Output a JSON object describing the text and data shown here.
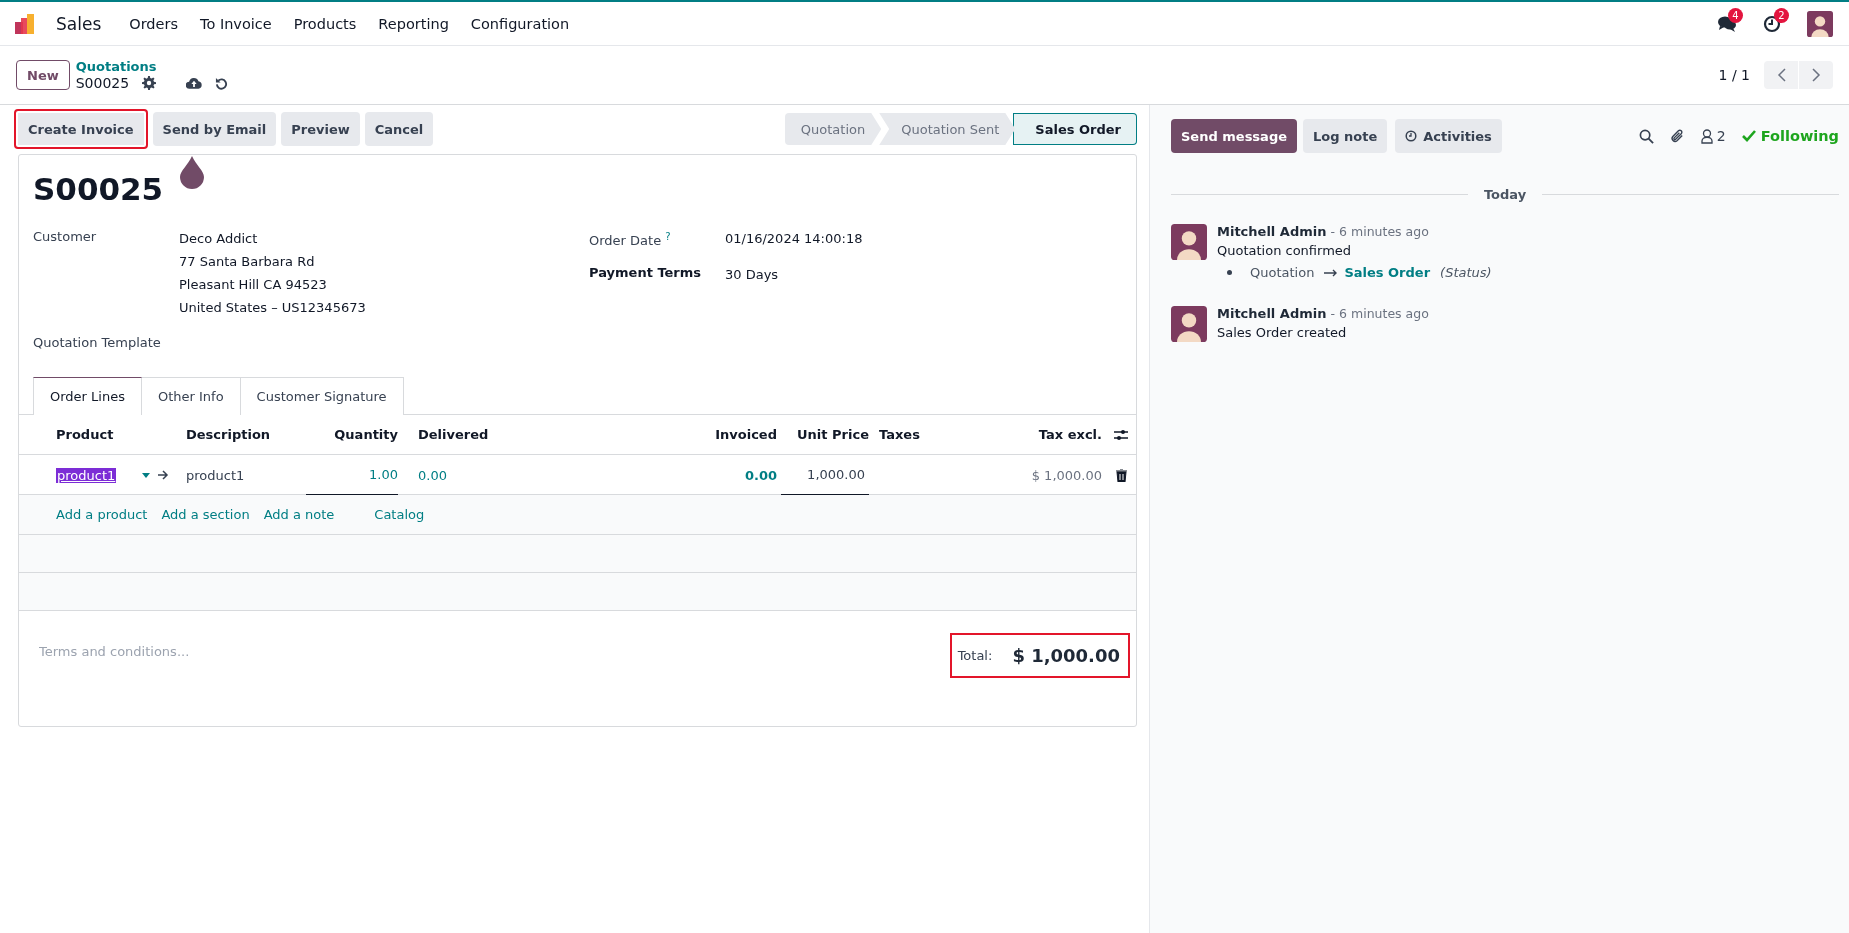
{
  "navbar": {
    "app": "Sales",
    "menus": [
      "Orders",
      "To Invoice",
      "Products",
      "Reporting",
      "Configuration"
    ],
    "messages_count": "4",
    "activities_count": "2"
  },
  "control_panel": {
    "new_button": "New",
    "breadcrumb": "Quotations",
    "record": "S00025",
    "pager": "1 / 1"
  },
  "action_buttons": [
    {
      "label": "Create Invoice",
      "highlighted": true
    },
    {
      "label": "Send by Email",
      "highlighted": false
    },
    {
      "label": "Preview",
      "highlighted": false
    },
    {
      "label": "Cancel",
      "highlighted": false
    }
  ],
  "statusbar": [
    {
      "label": "Quotation",
      "selected": false
    },
    {
      "label": "Quotation Sent",
      "selected": false
    },
    {
      "label": "Sales Order",
      "selected": true
    }
  ],
  "form": {
    "title": "S00025",
    "customer_label": "Customer",
    "customer_name": "Deco Addict",
    "address": [
      "77 Santa Barbara Rd",
      "Pleasant Hill CA 94523",
      "United States – US12345673"
    ],
    "template_label": "Quotation Template",
    "order_date_label": "Order Date",
    "help_mark": "?",
    "order_date": "01/16/2024 14:00:18",
    "payment_terms_label": "Payment Terms",
    "payment_terms": "30 Days"
  },
  "tabs": [
    {
      "label": "Order Lines",
      "selected": true
    },
    {
      "label": "Other Info",
      "selected": false
    },
    {
      "label": "Customer Signature",
      "selected": false
    }
  ],
  "table": {
    "columns": [
      "Product",
      "Description",
      "Quantity",
      "Delivered",
      "Invoiced",
      "Unit Price",
      "Taxes",
      "Tax excl."
    ],
    "rows": [
      {
        "product": "product1",
        "text_selected": true,
        "description": "product1",
        "quantity": "1.00",
        "delivered": "0.00",
        "invoiced": "0.00",
        "unit_price": "1,000.00",
        "tax_excl": "$ 1,000.00"
      }
    ],
    "add_links": [
      "Add a product",
      "Add a section",
      "Add a note",
      "Catalog"
    ]
  },
  "terms": {
    "placeholder": "Terms and conditions..."
  },
  "total": {
    "label": "Total:",
    "value": "$ 1,000.00",
    "highlighted": true
  },
  "chatter": {
    "buttons": [
      {
        "label": "Send message",
        "kind": "primary"
      },
      {
        "label": "Log note",
        "kind": "secondary"
      },
      {
        "label": "Activities",
        "kind": "activities"
      }
    ],
    "followers_count": "2",
    "following": "Following",
    "date_separator": "Today",
    "messages": [
      {
        "author": "Mitchell Admin",
        "time": "- 6 minutes ago",
        "body": "Quotation confirmed",
        "tracking": {
          "old": "Quotation",
          "new": "Sales Order",
          "field": "(Status)"
        }
      },
      {
        "author": "Mitchell Admin",
        "time": "- 6 minutes ago",
        "body": "Sales Order created"
      }
    ]
  }
}
